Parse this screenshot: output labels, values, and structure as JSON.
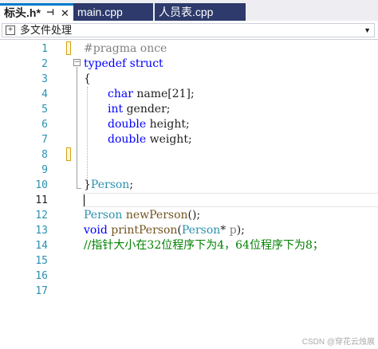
{
  "tabs": [
    {
      "label": "标头.h*",
      "active": true,
      "pin_icon": "pin-icon",
      "close_icon": "close-icon"
    },
    {
      "label": "main.cpp",
      "active": false
    },
    {
      "label": "人员表.cpp",
      "active": false
    }
  ],
  "navbar": {
    "scope_label": "多文件处理",
    "scope_icon": "scope-icon",
    "dropdown_icon": "chevron-down-icon"
  },
  "line_numbers": [
    "1",
    "2",
    "3",
    "4",
    "5",
    "6",
    "7",
    "8",
    "9",
    "10",
    "11",
    "12",
    "13",
    "14",
    "15",
    "16",
    "17"
  ],
  "code": {
    "l1": {
      "directive": "#pragma once"
    },
    "l2": {
      "kw_typedef": "typedef",
      "kw_struct": "struct"
    },
    "l3": {
      "brace": "{"
    },
    "l4": {
      "type": "char",
      "rest": " name[21];"
    },
    "l5": {
      "type": "int",
      "rest": " gender;"
    },
    "l6": {
      "type": "double",
      "rest": " height;"
    },
    "l7": {
      "type": "double",
      "rest": " weight;"
    },
    "l10": {
      "brace": "}",
      "name": "Person",
      "semi": ";"
    },
    "l12": {
      "ret": "Person",
      "fn": "newPerson",
      "rest": "();"
    },
    "l13": {
      "ret": "void",
      "fn": "printPerson",
      "open": "(",
      "ptype": "Person",
      "star": "* ",
      "pname": "p",
      "close": ");"
    },
    "l14": {
      "comment": "//指针大小在32位程序下为4，64位程序下为8；"
    }
  },
  "current_line": 11,
  "watermark": "CSDN @穿花云烛展",
  "colors": {
    "keyword": "#0000ff",
    "type": "#2b91af",
    "comment": "#008000",
    "preprocessor": "#808080",
    "function": "#74531f",
    "tab_inactive_bg": "#2d3a6b",
    "tab_active_accent": "#007acc"
  }
}
